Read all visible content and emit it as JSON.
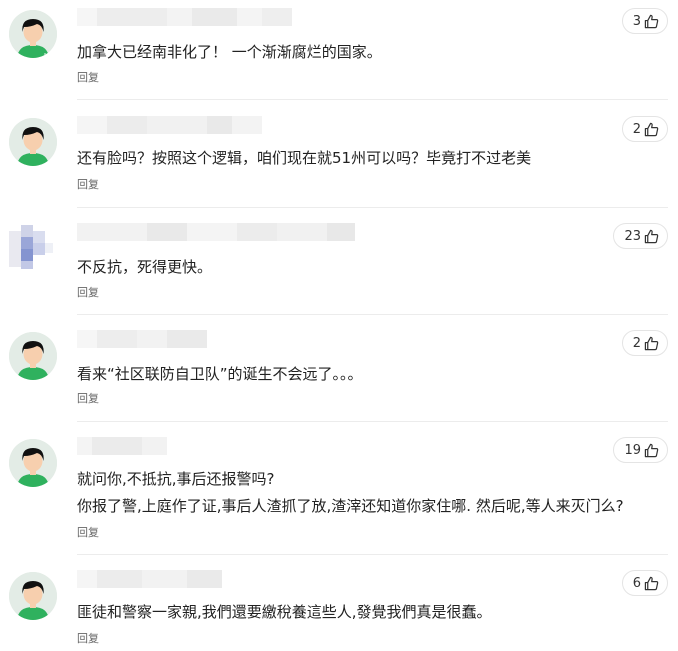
{
  "comments": [
    {
      "likes": "3",
      "lines": [
        "加拿大已经南非化了！ 一个渐渐腐烂的国家。"
      ],
      "reply": "回复"
    },
    {
      "likes": "2",
      "lines": [
        "还有脸吗？按照这个逻辑，咱们现在就51州可以吗？毕竟打不过老美"
      ],
      "reply": "回复"
    },
    {
      "likes": "23",
      "lines": [
        "不反抗，死得更快。"
      ],
      "reply": "回复"
    },
    {
      "likes": "2",
      "lines": [
        "看来“社区联防自卫队”的诞生不会远了。。。"
      ],
      "reply": "回复"
    },
    {
      "likes": "19",
      "lines": [
        "就问你,不抵抗,事后还报警吗?",
        "你报了警,上庭作了证,事后人渣抓了放,渣滓还知道你家住哪. 然后呢,等人来灭门么?"
      ],
      "reply": "回复"
    },
    {
      "likes": "6",
      "lines": [
        "匪徒和警察一家親,我們還要繳稅養這些人,發覺我們真是很蠢。"
      ],
      "reply": "回复"
    }
  ],
  "colors": {
    "avatar_bg": "#e3ece6",
    "avatar_shirt": "#2fb15e",
    "avatar_face": "#f7cfae",
    "avatar_hair": "#101010",
    "divider": "#ececec",
    "text": "#222222",
    "reply": "#666666"
  },
  "icons": {
    "like": "thumbs-up-icon",
    "avatar": "default-user-avatar"
  }
}
